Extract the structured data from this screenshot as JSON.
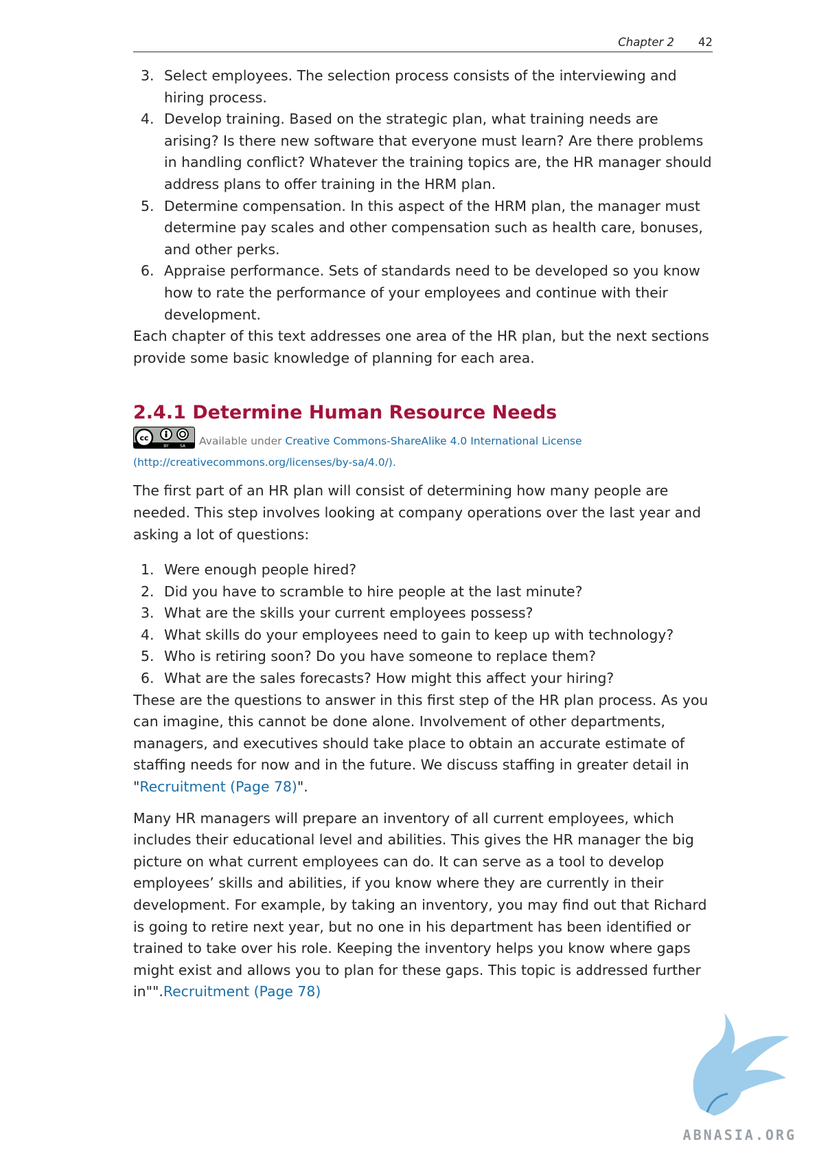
{
  "header": {
    "chapter": "Chapter 2",
    "page": "42"
  },
  "list_a": [
    {
      "num": "3.",
      "text": "Select employees. The selection process consists of the interviewing and hiring process."
    },
    {
      "num": "4.",
      "text": "Develop training. Based on the strategic plan, what training needs are arising? Is there new software that everyone must learn? Are there problems in handling conflict? Whatever the training topics are, the HR manager should address plans to offer training in the HRM plan."
    },
    {
      "num": "5.",
      "text": "Determine compensation. In this aspect of the HRM plan, the manager must determine pay scales and other compensation such as health care, bonuses, and other perks."
    },
    {
      "num": "6.",
      "text": "Appraise performance. Sets of standards need to be developed so you know how to rate the performance of your employees and continue with their development."
    }
  ],
  "para1": "Each chapter of this text addresses one area of the HR plan, but the next sections provide some basic knowledge of planning for each area.",
  "section": {
    "title": "2.4.1 Determine Human Resource Needs",
    "license_prefix": "Available under ",
    "license_link": "Creative Commons-ShareAlike 4.0 International License",
    "license_url": "(http://creativecommons.org/licenses/by-sa/4.0/).",
    "badge_cc": "cc",
    "badge_by": "BY",
    "badge_sa": "SA"
  },
  "para2": "The first part of an HR plan will consist of determining how many people are needed. This step involves looking at company operations over the last year and asking a lot of questions:",
  "list_b": [
    {
      "num": "1.",
      "text": "Were enough people hired?"
    },
    {
      "num": "2.",
      "text": "Did you have to scramble to hire people at the last minute?"
    },
    {
      "num": "3.",
      "text": "What are the skills your current employees possess?"
    },
    {
      "num": "4.",
      "text": "What skills do your employees need to gain to keep up with technology?"
    },
    {
      "num": "5.",
      "text": "Who is retiring soon? Do you have someone to replace them?"
    },
    {
      "num": "6.",
      "text": "What are the sales forecasts? How might this affect your hiring?"
    }
  ],
  "para3": {
    "text": "These are the questions to answer in this first step of the HR plan process. As you can imagine, this cannot be done alone. Involvement of other departments, managers, and executives should take place to obtain an accurate estimate of staffing needs for now and in the future. We discuss staffing in greater detail in \"",
    "link": "Recruitment (Page 78)",
    "suffix": "\"."
  },
  "para4": {
    "text": "Many HR managers will prepare an inventory of all current employees, which includes their educational level and abilities. This gives the HR manager the big picture on what current employees can do. It can serve as a tool to develop employees’ skills and abilities, if you know where they are currently in their development. For example, by taking an inventory, you may find out that Richard is going to retire next year, but no one in his department has been identified or trained to take over his role. Keeping the inventory helps you know where gaps might exist and allows you to plan for these gaps. This topic is addressed further in\"\".",
    "link": "Recruitment (Page 78)"
  },
  "watermark": {
    "text": "ABNASIA.ORG"
  }
}
